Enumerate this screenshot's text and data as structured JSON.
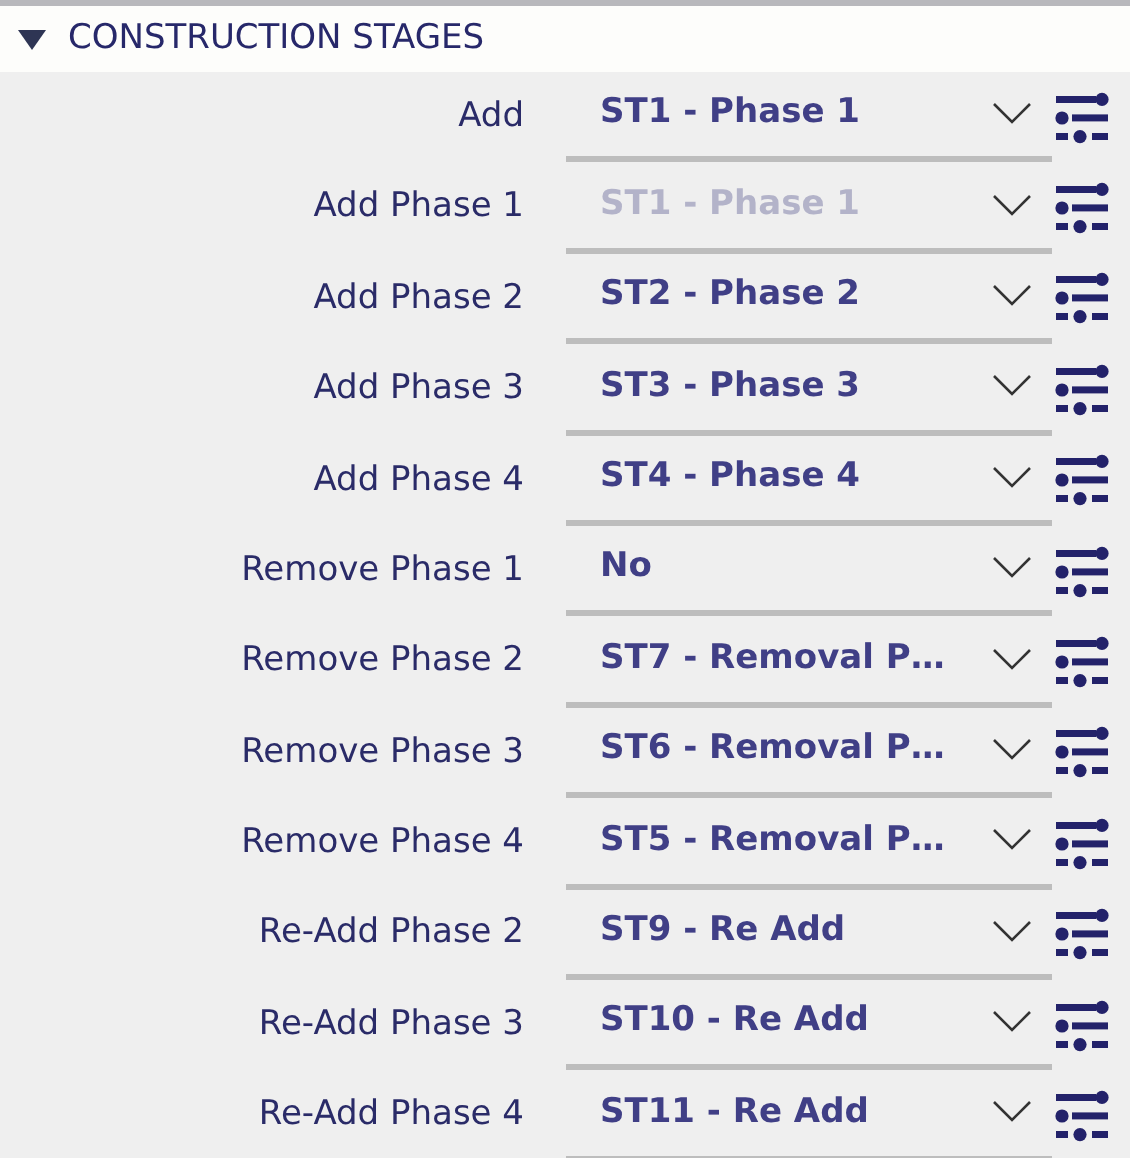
{
  "section": {
    "title": "CONSTRUCTION STAGES",
    "expanded": true
  },
  "rows": [
    {
      "label": "Add",
      "value": "ST1 - Phase 1",
      "disabled": false
    },
    {
      "label": "Add Phase 1",
      "value": "ST1 - Phase 1",
      "disabled": true
    },
    {
      "label": "Add Phase 2",
      "value": "ST2 - Phase 2",
      "disabled": false
    },
    {
      "label": "Add Phase 3",
      "value": "ST3 - Phase 3",
      "disabled": false
    },
    {
      "label": "Add Phase 4",
      "value": "ST4 - Phase 4",
      "disabled": false
    },
    {
      "label": "Remove Phase 1",
      "value": "No",
      "disabled": false
    },
    {
      "label": "Remove Phase 2",
      "value": "ST7 - Removal P…",
      "disabled": false
    },
    {
      "label": "Remove Phase 3",
      "value": "ST6 - Removal P…",
      "disabled": false
    },
    {
      "label": "Remove Phase 4",
      "value": "ST5 - Removal P…",
      "disabled": false
    },
    {
      "label": "Re-Add Phase 2",
      "value": "ST9 - Re Add",
      "disabled": false
    },
    {
      "label": "Re-Add Phase 3",
      "value": "ST10 - Re Add",
      "disabled": false
    },
    {
      "label": "Re-Add Phase 4",
      "value": "ST11 - Re Add",
      "disabled": false
    }
  ]
}
